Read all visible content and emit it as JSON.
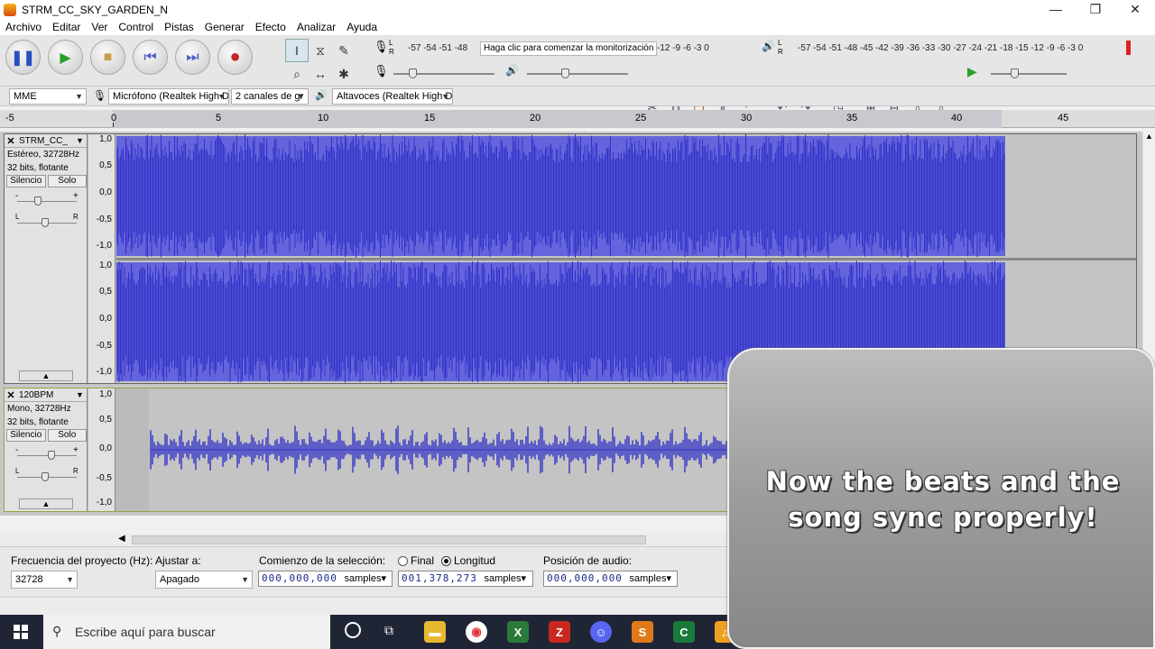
{
  "window": {
    "title": "STRM_CC_SKY_GARDEN_N",
    "controls": [
      "—",
      "❐",
      "✕"
    ]
  },
  "menu": [
    "Archivo",
    "Editar",
    "Ver",
    "Control",
    "Pistas",
    "Generar",
    "Efecto",
    "Analizar",
    "Ayuda"
  ],
  "meters": {
    "record_scale": "-57 -54 -51 -48",
    "record_scale_right": "-12  -9  -6  -3  0",
    "monitor_button": "Haga clic para comenzar la monitorización",
    "play_scale": "-57 -54 -51 -48 -45 -42 -39 -36 -33 -30 -27 -24 -21 -18 -15 -12  -9  -6  -3  0",
    "lr_label_l": "L",
    "lr_label_r": "R"
  },
  "devices": {
    "host": "MME",
    "mic": "Micrófono (Realtek High D",
    "channels": "2 canales de gr",
    "speakers": "Altavoces (Realtek High D"
  },
  "ruler": {
    "ticks": [
      "-5",
      "0",
      "5",
      "10",
      "15",
      "20",
      "25",
      "30",
      "35",
      "40",
      "45"
    ]
  },
  "tracks": [
    {
      "name": "STRM_CC_",
      "format": "Estéreo, 32728Hz",
      "bits": "32 bits, flotante",
      "mute": "Silencio",
      "solo": "Solo",
      "gain_l": "-",
      "gain_r": "+",
      "pan_l": "L",
      "pan_r": "R",
      "scale": [
        "1,0",
        "0,5",
        "0,0",
        "-0,5",
        "-1,0"
      ]
    },
    {
      "name": "120BPM",
      "format": "Mono, 32728Hz",
      "bits": "32 bits, flotante",
      "mute": "Silencio",
      "solo": "Solo",
      "gain_l": "-",
      "gain_r": "+",
      "pan_l": "L",
      "pan_r": "R",
      "scale": [
        "1,0",
        "0,5",
        "0,0",
        "-0,5",
        "-1,0"
      ]
    }
  ],
  "selection": {
    "rate_label": "Frecuencia del proyecto (Hz):",
    "rate_value": "32728",
    "snap_label": "Ajustar a:",
    "snap_value": "Apagado",
    "start_label": "Comienzo de la selección:",
    "start_value": "000,000,000",
    "end_option": "Final",
    "length_option": "Longitud",
    "length_value": "001,378,273",
    "position_label": "Posición de audio:",
    "position_value": "000,000,000",
    "units": "samples"
  },
  "taskbar": {
    "search_placeholder": "Escribe aquí para buscar"
  },
  "overlay": {
    "caption": "Now the beats and the song sync properly!"
  },
  "colors": {
    "waveform": "#3232c8",
    "waveform_light": "#6464dc",
    "background": "#c4c4c4"
  }
}
